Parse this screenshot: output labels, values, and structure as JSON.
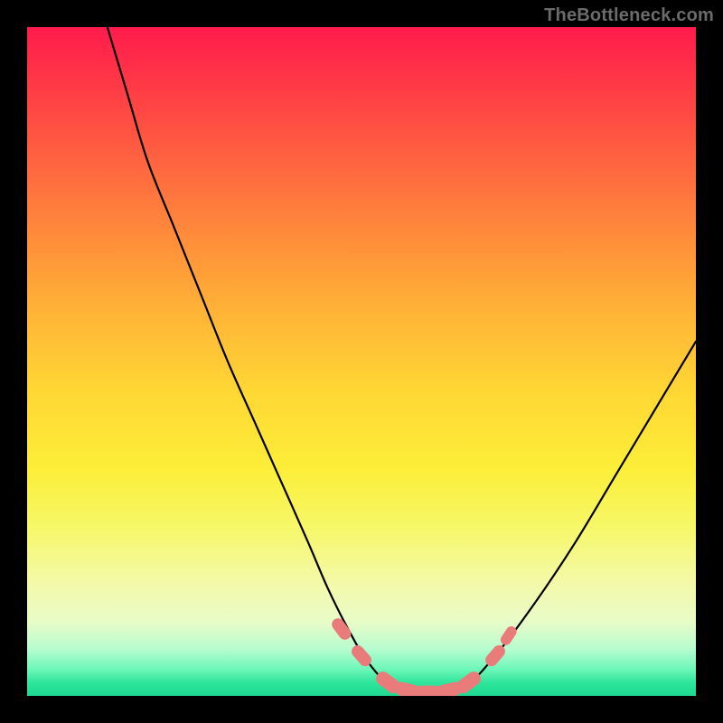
{
  "watermark": "TheBottleneck.com",
  "chart_data": {
    "type": "line",
    "title": "",
    "xlabel": "",
    "ylabel": "",
    "xlim": [
      0,
      100
    ],
    "ylim": [
      0,
      100
    ],
    "grid": false,
    "legend": false,
    "background_gradient_stops": [
      {
        "pct": 0,
        "color": "#ff1b4c"
      },
      {
        "pct": 10,
        "color": "#ff3e45"
      },
      {
        "pct": 22,
        "color": "#ff6b3f"
      },
      {
        "pct": 33,
        "color": "#ff923a"
      },
      {
        "pct": 44,
        "color": "#ffb836"
      },
      {
        "pct": 55,
        "color": "#ffd834"
      },
      {
        "pct": 66,
        "color": "#fcee38"
      },
      {
        "pct": 75,
        "color": "#f6f86a"
      },
      {
        "pct": 83,
        "color": "#f4f9a8"
      },
      {
        "pct": 89,
        "color": "#e8fcc8"
      },
      {
        "pct": 93,
        "color": "#b6fccf"
      },
      {
        "pct": 96,
        "color": "#6ef7b8"
      },
      {
        "pct": 98,
        "color": "#2fe59c"
      },
      {
        "pct": 100,
        "color": "#1dd98f"
      }
    ],
    "series": [
      {
        "name": "bottleneck-curve",
        "color": "#000000",
        "stroke_width": 2.2,
        "x": [
          12,
          15,
          18,
          22,
          26,
          30,
          34,
          38,
          42,
          45,
          48,
          51,
          55,
          60,
          65,
          70,
          76,
          82,
          88,
          94,
          100
        ],
        "y": [
          100,
          90,
          80,
          70,
          60,
          50,
          41,
          32,
          23,
          16,
          10,
          5,
          1,
          0,
          1,
          6,
          14,
          23,
          33,
          43,
          53
        ]
      }
    ],
    "markers": {
      "name": "highlight-bumps",
      "color": "#e97c7a",
      "points": [
        {
          "x": 47,
          "y": 10,
          "r": 1.4
        },
        {
          "x": 50,
          "y": 6,
          "r": 1.4
        },
        {
          "x": 54,
          "y": 2,
          "r": 1.6
        },
        {
          "x": 57,
          "y": 0.8,
          "r": 1.6
        },
        {
          "x": 60,
          "y": 0.5,
          "r": 1.6
        },
        {
          "x": 63,
          "y": 0.8,
          "r": 1.6
        },
        {
          "x": 66,
          "y": 2,
          "r": 1.6
        },
        {
          "x": 70,
          "y": 6,
          "r": 1.4
        },
        {
          "x": 72,
          "y": 9,
          "r": 1.2
        }
      ]
    }
  }
}
